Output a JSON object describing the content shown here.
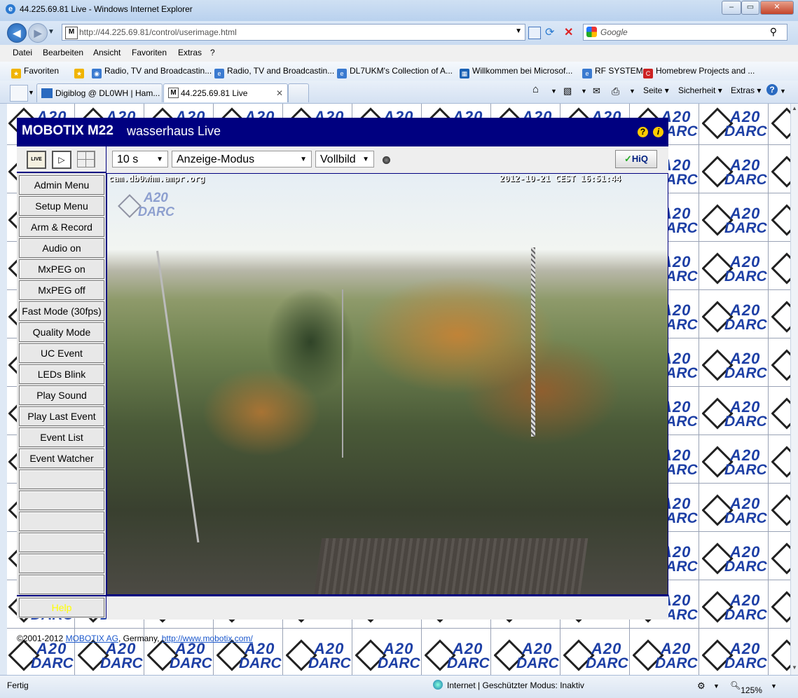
{
  "window": {
    "title": "44.225.69.81 Live - Windows Internet Explorer",
    "minimize": "‒",
    "maximize": "▭",
    "close": "✕"
  },
  "address": {
    "url": "http://44.225.69.81/control/userimage.html",
    "search_placeholder": "Google"
  },
  "menu": [
    "Datei",
    "Bearbeiten",
    "Ansicht",
    "Favoriten",
    "Extras",
    "?"
  ],
  "favorites": {
    "label": "Favoriten",
    "items": [
      "Radio, TV and Broadcastin...",
      "Radio, TV and Broadcastin...",
      "DL7UKM's Collection of A...",
      "Willkommen bei Microsof...",
      "RF SYSTEM",
      "Homebrew Projects and ..."
    ]
  },
  "tabs": [
    {
      "label": "Digiblog @ DL0WH | Ham..."
    },
    {
      "label": "44.225.69.81 Live"
    }
  ],
  "commands": {
    "seite": "Seite",
    "sicherheit": "Sicherheit",
    "extras": "Extras"
  },
  "background_tile": {
    "top": "A20",
    "bottom": "DARC"
  },
  "mobotix": {
    "model": "MOBOTIX M22",
    "camera_name": "wasserhaus Live",
    "view_live": "LIVE",
    "sidebar": [
      "Admin Menu",
      "Setup Menu",
      "Arm & Record",
      "Audio on",
      "MxPEG on",
      "MxPEG off",
      "Fast Mode (30fps)",
      "Quality Mode",
      "UC Event",
      "LEDs Blink",
      "Play Sound",
      "Play Last Event",
      "Event List",
      "Event Watcher"
    ],
    "help": "Help",
    "toolbar": {
      "interval": "10 s",
      "mode": "Anzeige-Modus",
      "size": "Vollbild",
      "hiq": "HiQ"
    },
    "image": {
      "overlay_left": "cam.db0whm.ampr.org",
      "overlay_right": "2012-10-21 CEST 16:51:44"
    },
    "footer": {
      "copyright": "©2001-2012",
      "company": "MOBOTIX AG",
      "country": ", Germany,",
      "link": "http://www.mobotix.com/"
    }
  },
  "status": {
    "left": "Fertig",
    "zone": "Internet | Geschützter Modus: Inaktiv",
    "zoom": "125%"
  }
}
